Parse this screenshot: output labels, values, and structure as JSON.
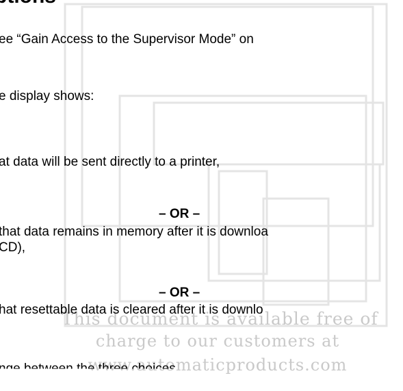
{
  "heading": "ptions",
  "lines": {
    "l1": "ee “Gain Access to the Supervisor Mode” on",
    "l2": "e display shows:",
    "l3": "at data will be sent directly to a printer,",
    "l4": "that data remains in memory after it is downloa",
    "l5": "CD),",
    "l6": "hat resettable data is cleared after it is downlo",
    "l7": "nge between the three choices."
  },
  "or_label": "– OR –",
  "watermark": {
    "line1": "This document is available free of",
    "line2": "charge to our customers at",
    "line3": "www.automaticproducts.com"
  }
}
